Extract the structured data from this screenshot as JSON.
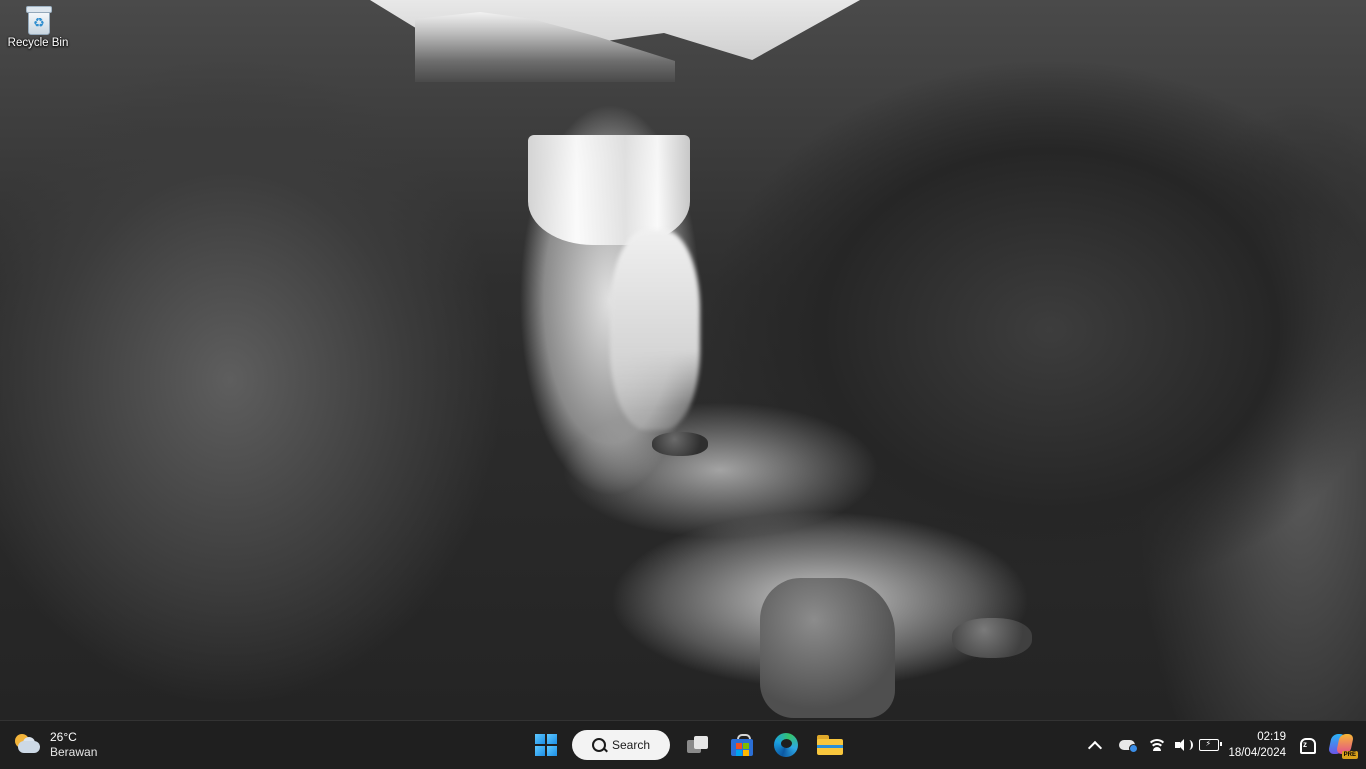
{
  "desktop": {
    "icons": [
      {
        "label": "Recycle Bin",
        "icon": "recycle-bin-icon"
      }
    ]
  },
  "taskbar": {
    "weather": {
      "temperature": "26°C",
      "condition": "Berawan",
      "icon": "partly-cloudy-icon"
    },
    "search": {
      "label": "Search"
    },
    "pinned": [
      {
        "name": "Start",
        "icon": "windows-start-icon"
      },
      {
        "name": "Search",
        "icon": "search-icon"
      },
      {
        "name": "Task View",
        "icon": "task-view-icon"
      },
      {
        "name": "Microsoft Store",
        "icon": "store-icon"
      },
      {
        "name": "Microsoft Edge",
        "icon": "edge-icon"
      },
      {
        "name": "File Explorer",
        "icon": "file-explorer-icon"
      }
    ],
    "tray": {
      "time": "02:19",
      "date": "18/04/2024",
      "copilot_badge": "PRE"
    }
  },
  "colors": {
    "taskbar_bg": "#1f1f1f",
    "accent": "#1d8fe6",
    "search_bg": "#f3f3f3"
  }
}
